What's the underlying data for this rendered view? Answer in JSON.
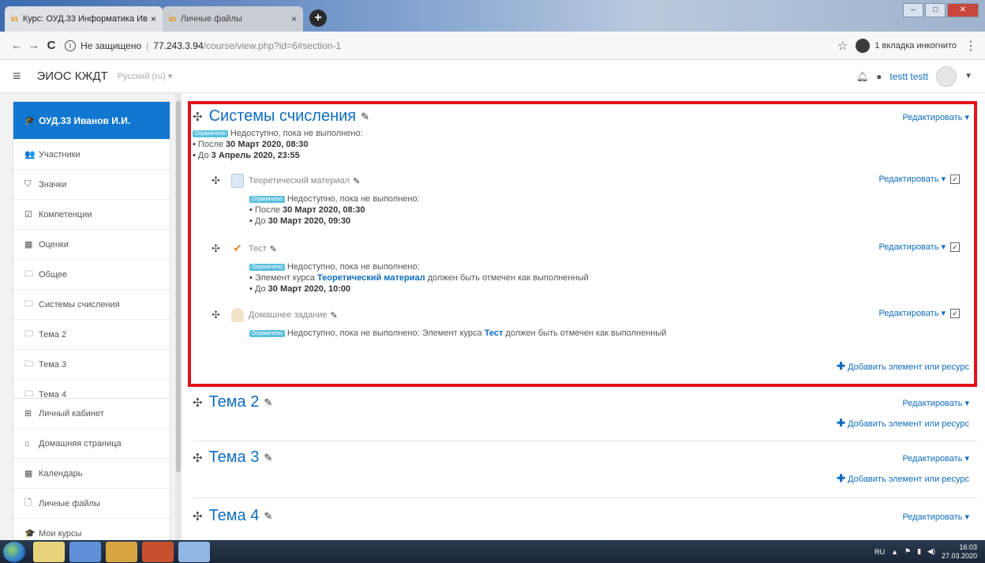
{
  "browser": {
    "tabs": [
      {
        "favicon": "in",
        "title": "Курс: ОУД.33 Информатика Ив",
        "close": "×"
      },
      {
        "favicon": "in",
        "title": "Личные файлы",
        "close": "×"
      }
    ],
    "new_tab": "+",
    "window_controls": [
      "–",
      "□",
      "✕"
    ],
    "address": {
      "security": "Не защищено",
      "host": "77.243.3.94",
      "path": "/course/view.php?id=6#section-1"
    },
    "incognito_label": "1 вкладка инкогнито"
  },
  "header": {
    "site_name": "ЭИОС КЖДТ",
    "language": "Русский (ru) ▾",
    "user_name": "testt testt"
  },
  "sidebar": {
    "course_items": [
      {
        "icon": "graduation-cap-icon",
        "glyph": "🎓",
        "label": "ОУД.33 Иванов И.И.",
        "active": true
      },
      {
        "icon": "users-icon",
        "glyph": "👥",
        "label": "Участники"
      },
      {
        "icon": "shield-icon",
        "glyph": "⛉",
        "label": "Значки"
      },
      {
        "icon": "checkbox-icon",
        "glyph": "☑",
        "label": "Компетенции"
      },
      {
        "icon": "table-icon",
        "glyph": "▦",
        "label": "Оценки"
      },
      {
        "icon": "folder-icon",
        "glyph": "🗀",
        "label": "Общее"
      },
      {
        "icon": "folder-icon",
        "glyph": "🗀",
        "label": "Системы счисления"
      },
      {
        "icon": "folder-icon",
        "glyph": "🗀",
        "label": "Тема 2"
      },
      {
        "icon": "folder-icon",
        "glyph": "🗀",
        "label": "Тема 3"
      },
      {
        "icon": "folder-icon",
        "glyph": "🗀",
        "label": "Тема 4"
      }
    ],
    "site_items": [
      {
        "icon": "dashboard-icon",
        "glyph": "⊞",
        "label": "Личный кабинет"
      },
      {
        "icon": "home-icon",
        "glyph": "⌂",
        "label": "Домашняя страница"
      },
      {
        "icon": "calendar-icon",
        "glyph": "▦",
        "label": "Календарь"
      },
      {
        "icon": "file-icon",
        "glyph": "🗋",
        "label": "Личные файлы"
      },
      {
        "icon": "graduation-cap-icon",
        "glyph": "🎓",
        "label": "Мои курсы"
      }
    ]
  },
  "labels": {
    "edit": "Редактировать ▾",
    "badge": "Ограничено",
    "unavailable": "Недоступно, пока не выполнено:",
    "add_resource": "Добавить элемент или ресурс"
  },
  "section1": {
    "title": "Системы счисления",
    "restrictions": {
      "after_prefix": "После ",
      "after_date": "30 Март 2020, 08:30",
      "until_prefix": "До ",
      "until_date": "3 Апрель 2020, 23:55"
    },
    "activities": [
      {
        "name": "Теоретический материал",
        "after_prefix": "После ",
        "after_date": "30 Март 2020, 08:30",
        "until_prefix": "До ",
        "until_date": "30 Март 2020, 09:30"
      },
      {
        "name": "Тест",
        "cond_prefix": "Элемент курса ",
        "cond_link": "Теоретический материал",
        "cond_suffix": " должен быть отмечен как выполненный",
        "until_prefix": "До ",
        "until_date": "30 Март 2020, 10:00"
      },
      {
        "name": "Домашнее задание",
        "cond_prefix": "Недоступно, пока не выполнено: Элемент курса ",
        "cond_link": "Тест",
        "cond_suffix": " должен быть отмечен как выполненный"
      }
    ]
  },
  "sections": [
    {
      "title": "Тема 2"
    },
    {
      "title": "Тема 3"
    },
    {
      "title": "Тема 4"
    }
  ],
  "taskbar": {
    "lang": "RU",
    "time": "16:03",
    "date": "27.03.2020"
  }
}
